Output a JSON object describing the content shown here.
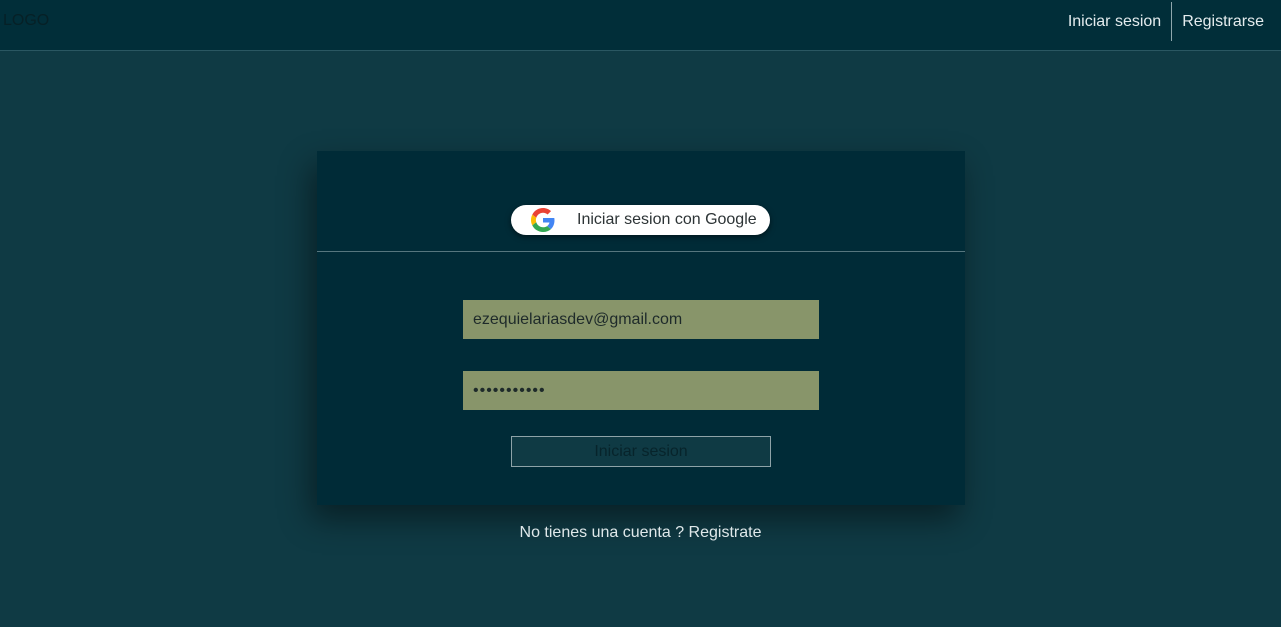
{
  "navbar": {
    "logo": "LOGO",
    "links": [
      {
        "label": "Iniciar sesion"
      },
      {
        "label": "Registrarse"
      }
    ]
  },
  "card": {
    "google_button_label": "Iniciar sesion con Google",
    "google_icon": "google-icon",
    "email_value": "ezequielariasdev@gmail.com",
    "password_value": "•••••••••••",
    "submit_label": "Iniciar sesion"
  },
  "footer": {
    "prompt": "No tienes una cuenta ?",
    "link": "Registrate"
  },
  "colors": {
    "page_background": "#0f3a44",
    "navbar_background": "#012e39",
    "card_background": "#002b37",
    "input_background": "#88956a"
  }
}
